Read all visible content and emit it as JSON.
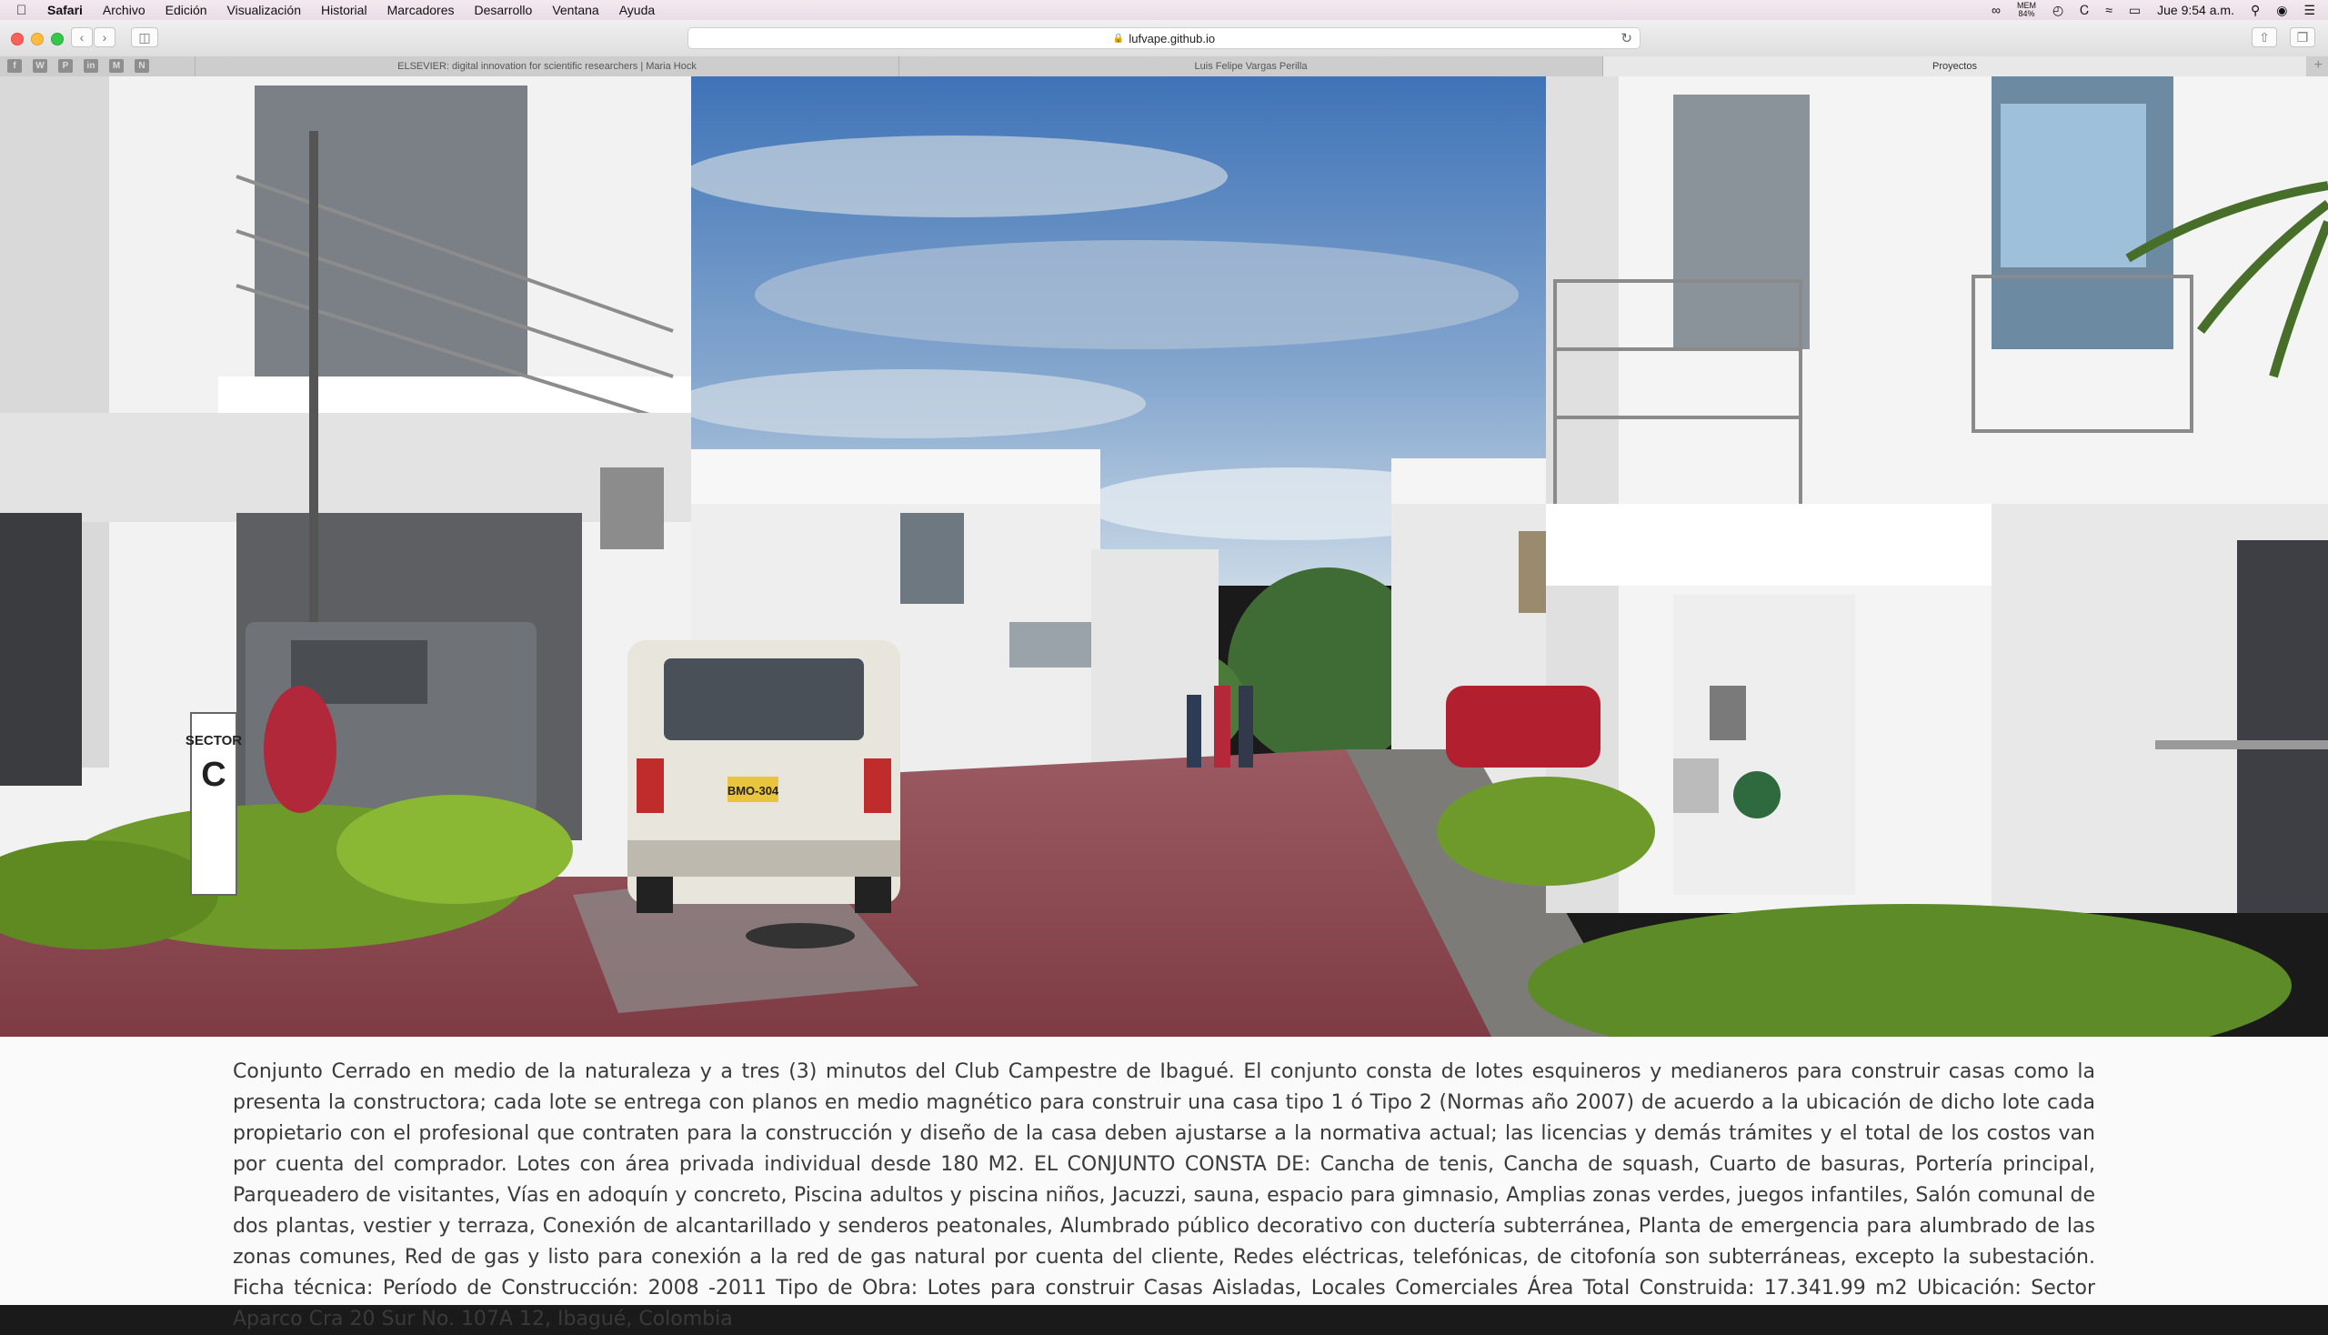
{
  "menubar": {
    "app": "Safari",
    "items": [
      "Archivo",
      "Edición",
      "Visualización",
      "Historial",
      "Marcadores",
      "Desarrollo",
      "Ventana",
      "Ayuda"
    ],
    "battery_top": "MEM",
    "battery_bottom": "84%",
    "clock": "Jue 9:54 a.m."
  },
  "toolbar": {
    "url": "lufvape.github.io"
  },
  "tabs": [
    {
      "title": "ELSEVIER: digital innovation for scientific researchers | Maria Hock",
      "active": false
    },
    {
      "title": "Luis Felipe Vargas Perilla",
      "active": false
    },
    {
      "title": "Proyectos",
      "active": true
    }
  ],
  "favorites": [
    "f",
    "W",
    "P",
    "in",
    "M",
    "N"
  ],
  "slideshow": {
    "slide_count": 7,
    "active_index": 5,
    "scene": {
      "sign_line1": "SECTOR",
      "sign_line2": "C",
      "plate": "BMO-304"
    }
  },
  "description": "Conjunto Cerrado en medio de la naturaleza y a tres (3) minutos del Club Campestre de Ibagué. El conjunto consta de lotes esquineros y medianeros para construir casas como la presenta la constructora; cada lote se entrega con planos en medio magnético para construir una casa tipo 1 ó Tipo 2 (Normas año 2007) de acuerdo a la ubicación de dicho lote cada propietario con el profesional que contraten para la construcción y diseño de la casa deben ajustarse a la normativa actual; las licencias y demás trámites y el total de los costos van por cuenta del comprador. Lotes con área privada individual desde 180 M2. EL CONJUNTO CONSTA DE: Cancha de tenis, Cancha de squash, Cuarto de basuras, Portería principal, Parqueadero de visitantes, Vías en adoquín y concreto, Piscina adultos y piscina niños, Jacuzzi, sauna, espacio para gimnasio, Amplias zonas verdes, juegos infantiles, Salón comunal de dos plantas, vestier y terraza, Conexión de alcantarillado y senderos peatonales, Alumbrado público decorativo con ductería subterránea, Planta de emergencia para alumbrado de las zonas comunes, Red de gas y listo para conexión a la red de gas natural por cuenta del cliente, Redes eléctricas, telefónicas, de citofonía son subterráneas, excepto la subestación. Ficha técnica: Período de Construcción: 2008 -2011 Tipo de Obra: Lotes para construir Casas Aisladas, Locales Comerciales Área Total Construida: 17.341.99 m2 Ubicación: Sector Aparco Cra 20 Sur No. 107A  12, Ibagué, Colombia"
}
